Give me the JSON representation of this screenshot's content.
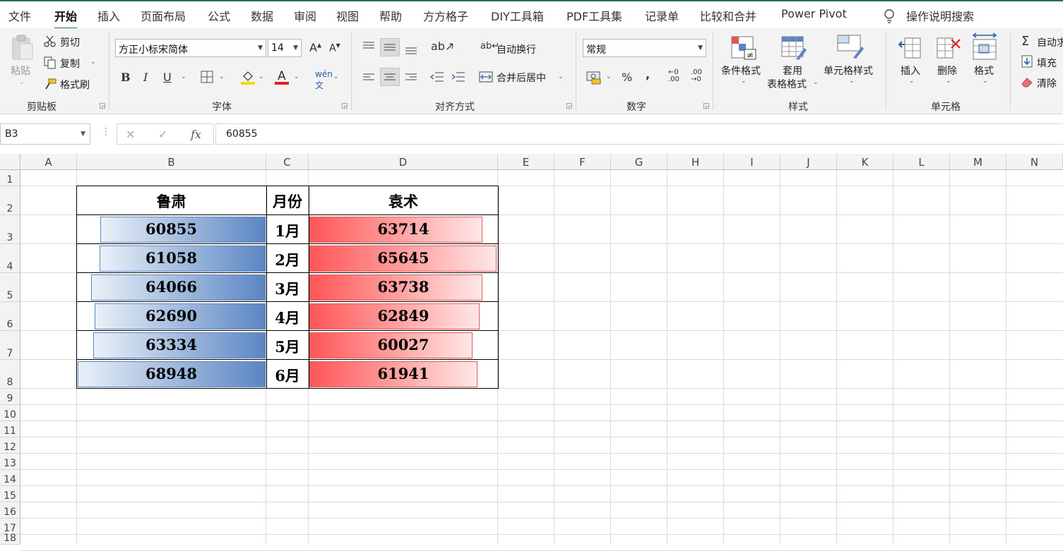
{
  "ribbon_tabs": [
    "文件",
    "开始",
    "插入",
    "页面布局",
    "公式",
    "数据",
    "审阅",
    "视图",
    "帮助",
    "方方格子",
    "DIY工具箱",
    "PDF工具集",
    "记录单",
    "比较和合并",
    "Power Pivot"
  ],
  "search_label": "操作说明搜索",
  "clipboard": {
    "paste": "粘贴",
    "cut": "剪切",
    "copy": "复制",
    "format_painter": "格式刷",
    "group": "剪贴板"
  },
  "font": {
    "name": "方正小标宋简体",
    "size": "14",
    "group": "字体",
    "bold": "B",
    "italic": "I",
    "underline": "U"
  },
  "alignment": {
    "wrap": "自动换行",
    "merge": "合并后居中",
    "group": "对齐方式"
  },
  "number": {
    "format": "常规",
    "group": "数字",
    "percent": "%",
    "comma": ","
  },
  "styles": {
    "conditional": "条件格式",
    "table_format_1": "套用",
    "table_format_2": "表格格式",
    "cell_styles": "单元格样式",
    "group": "样式"
  },
  "cells": {
    "insert": "插入",
    "delete": "删除",
    "format": "格式",
    "group": "单元格"
  },
  "editing": {
    "autosum": "自动求",
    "fill": "填充",
    "clear": "清除"
  },
  "formula_bar": {
    "name_box": "B3",
    "value": "60855"
  },
  "columns": [
    "A",
    "B",
    "C",
    "D",
    "E",
    "F",
    "G",
    "H",
    "I",
    "J",
    "K",
    "L",
    "M",
    "N"
  ],
  "rows": [
    "1",
    "2",
    "3",
    "4",
    "5",
    "6",
    "7",
    "8",
    "9",
    "10",
    "11",
    "12",
    "13",
    "14",
    "15",
    "16",
    "17",
    "18"
  ],
  "table": {
    "headers": [
      "鲁肃",
      "月份",
      "袁术"
    ],
    "rows": [
      {
        "b": "60855",
        "c": "1月",
        "d": "63714",
        "b_fill": 0.881,
        "d_fill": 0.924
      },
      {
        "b": "61058",
        "c": "2月",
        "d": "65645",
        "b_fill": 0.885,
        "d_fill": 1.0
      },
      {
        "b": "64066",
        "c": "3月",
        "d": "63738",
        "b_fill": 0.929,
        "d_fill": 0.924
      },
      {
        "b": "62690",
        "c": "4月",
        "d": "62849",
        "b_fill": 0.909,
        "d_fill": 0.911
      },
      {
        "b": "63334",
        "c": "5月",
        "d": "60027",
        "b_fill": 0.918,
        "d_fill": 0.87
      },
      {
        "b": "68948",
        "c": "6月",
        "d": "61941",
        "b_fill": 1.0,
        "d_fill": 0.898
      }
    ]
  },
  "colors": {
    "accent": "#217346",
    "bar_blue": "#5b86c3",
    "bar_red": "#ff5656"
  }
}
